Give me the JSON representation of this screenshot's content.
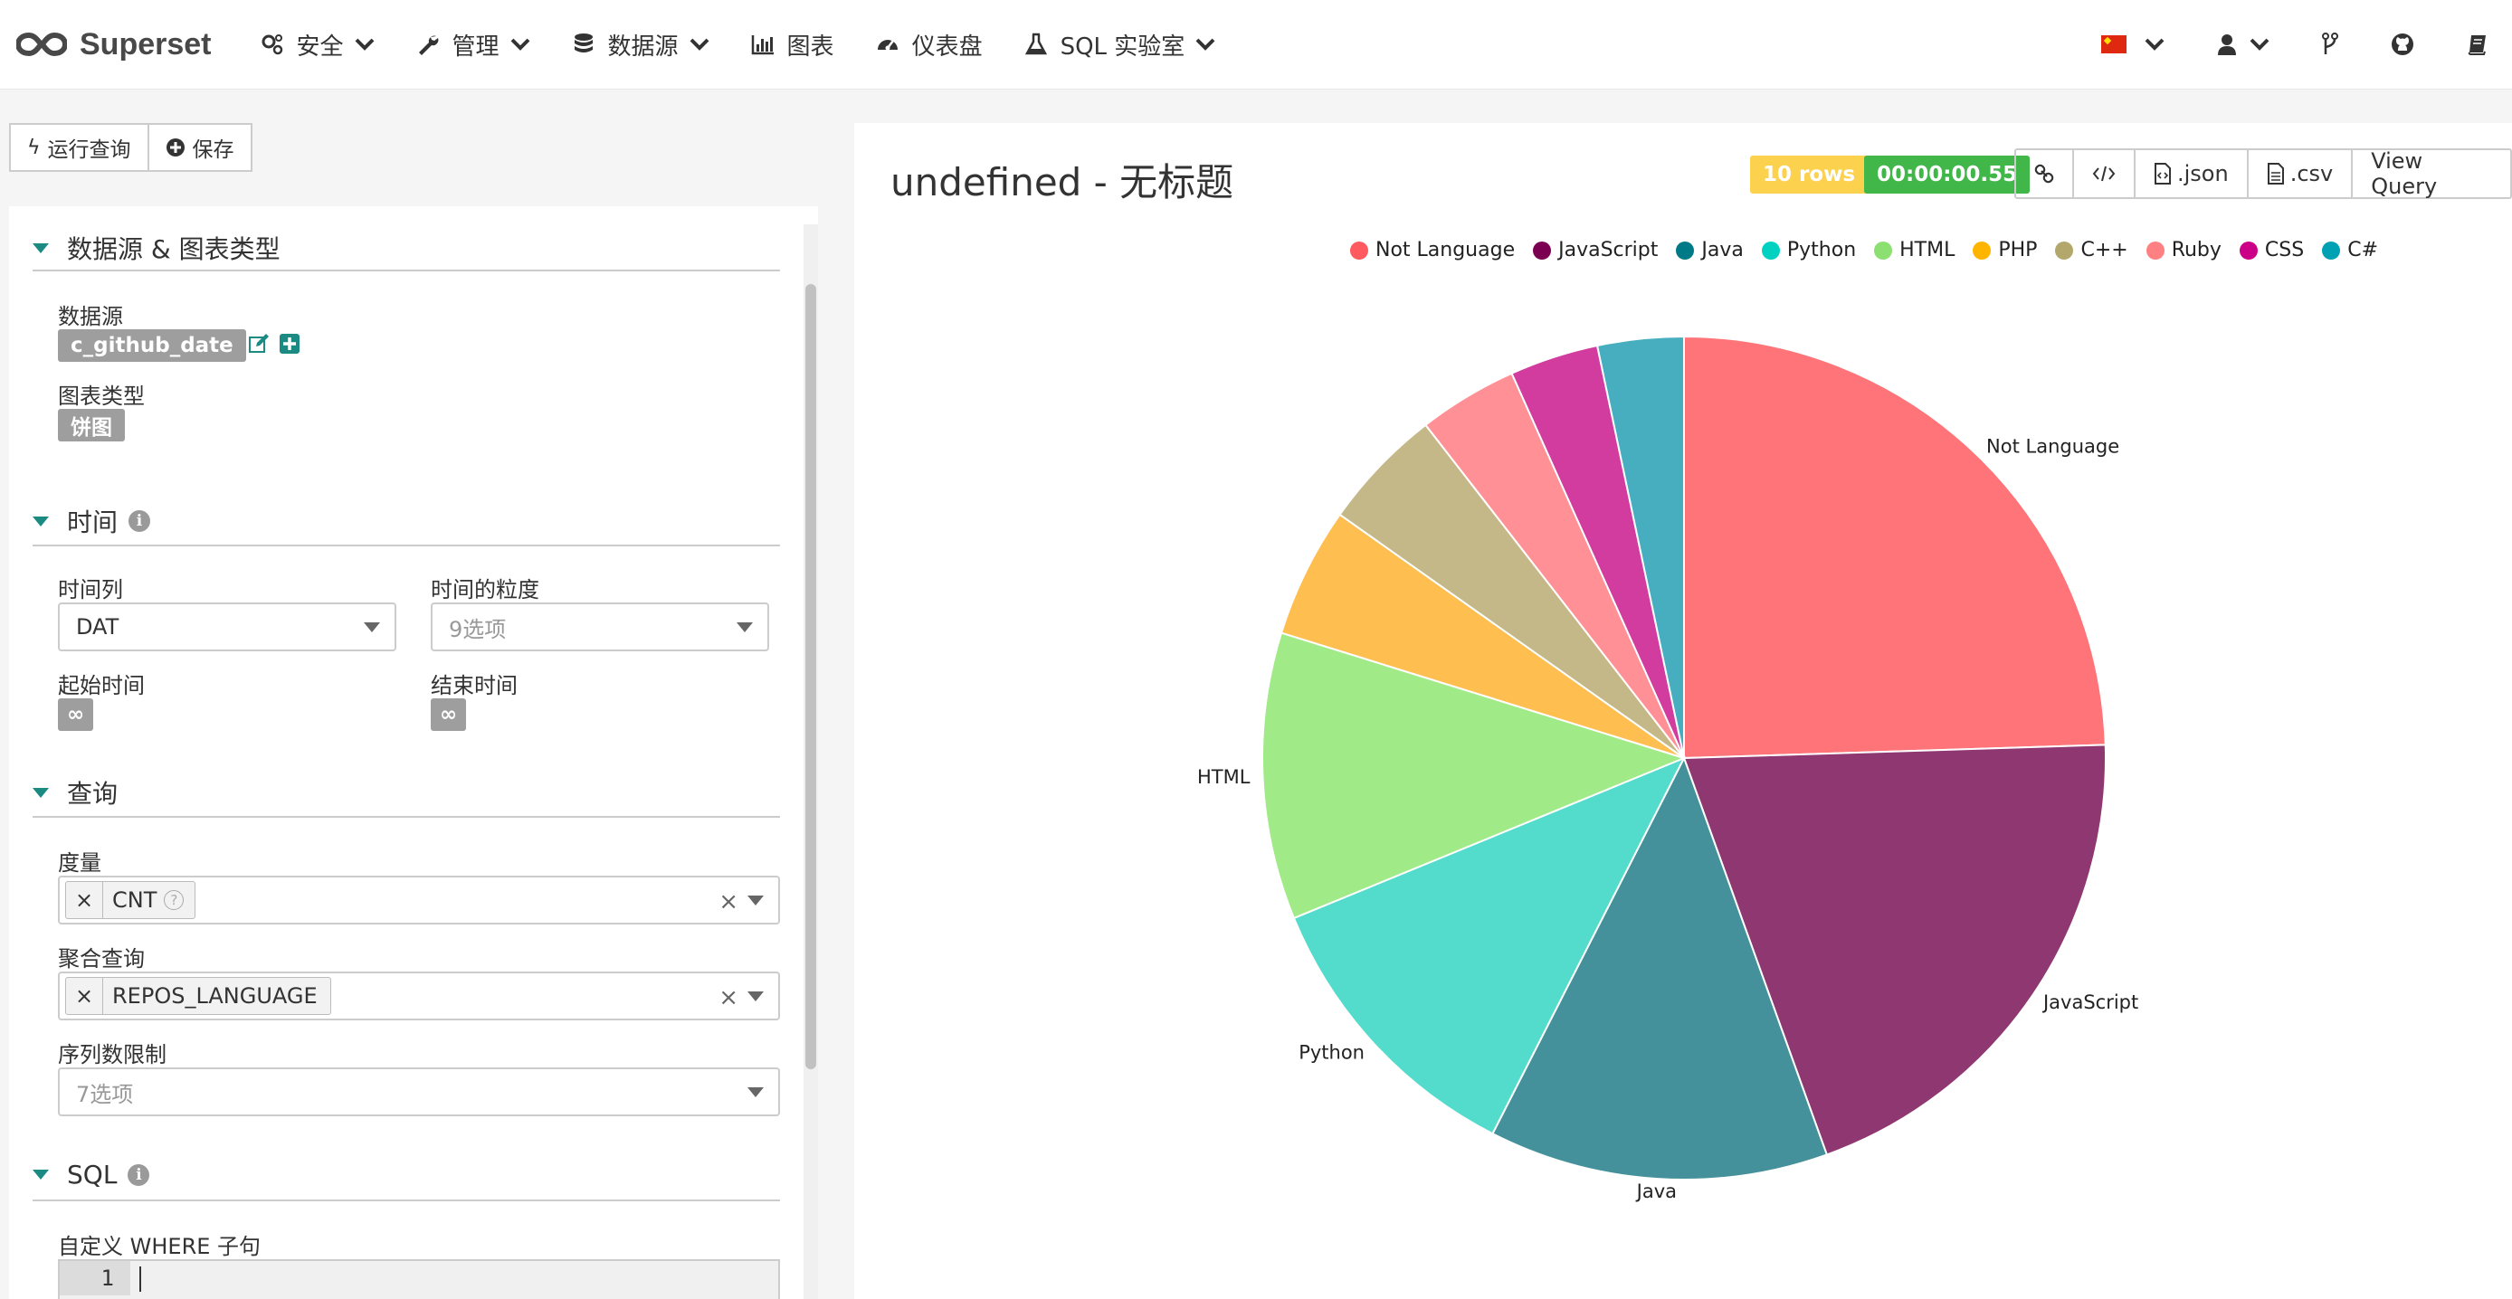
{
  "navbar": {
    "brand": "Superset",
    "items": [
      {
        "label": "安全",
        "icon": "gears-icon",
        "dropdown": true
      },
      {
        "label": "管理",
        "icon": "wrench-icon",
        "dropdown": true
      },
      {
        "label": "数据源",
        "icon": "database-icon",
        "dropdown": true
      },
      {
        "label": "图表",
        "icon": "bar-chart-icon",
        "dropdown": false
      },
      {
        "label": "仪表盘",
        "icon": "dashboard-icon",
        "dropdown": false
      },
      {
        "label": "SQL 实验室",
        "icon": "flask-icon",
        "dropdown": true
      }
    ],
    "right_icons": [
      "flag-cn-icon",
      "user-icon",
      "code-fork-icon",
      "github-icon",
      "book-icon"
    ]
  },
  "toolbar": {
    "run_label": "运行查询",
    "save_label": "保存"
  },
  "left_panel": {
    "section_datasource": {
      "title": "数据源 & 图表类型",
      "datasource_label": "数据源",
      "datasource_value": "c_github_date",
      "viz_type_label": "图表类型",
      "viz_type_value": "饼图"
    },
    "section_time": {
      "title": "时间",
      "time_column_label": "时间列",
      "time_column_value": "DAT",
      "time_grain_label": "时间的粒度",
      "time_grain_placeholder": "9选项",
      "since_label": "起始时间",
      "since_value": "∞",
      "until_label": "结束时间",
      "until_value": "∞"
    },
    "section_query": {
      "title": "查询",
      "metrics_label": "度量",
      "metrics_value": "CNT",
      "groupby_label": "聚合查询",
      "groupby_value": "REPOS_LANGUAGE",
      "row_limit_label": "序列数限制",
      "row_limit_placeholder": "7选项"
    },
    "section_sql": {
      "title": "SQL",
      "where_label": "自定义 WHERE 子句",
      "line_number": "1"
    }
  },
  "chart_panel": {
    "title": "undefined - 无标题",
    "rows_badge": "10 rows",
    "time_badge": "00:00:00.55",
    "buttons": {
      "link_icon": "link-icon",
      "embed_icon": "code-icon",
      "json_label": ".json",
      "csv_label": ".csv",
      "view_query_label": "View Query"
    }
  },
  "chart_data": {
    "type": "pie",
    "categories": [
      "Not Language",
      "JavaScript",
      "Java",
      "Python",
      "HTML",
      "PHP",
      "C++",
      "Ruby",
      "CSS",
      "C#"
    ],
    "values": [
      24.5,
      20.0,
      13.0,
      11.3,
      11.0,
      5.0,
      4.7,
      3.8,
      3.4,
      3.3
    ],
    "colors": [
      "#ff7478",
      "#8e3770",
      "#45919b",
      "#53dccb",
      "#a0ea87",
      "#ffbe50",
      "#c4b888",
      "#ff9096",
      "#d23c9e",
      "#47aec0"
    ],
    "legend_colors": [
      "#ff5a5f",
      "#7b0051",
      "#007a87",
      "#00d1c1",
      "#8ce071",
      "#ffb400",
      "#b4a76c",
      "#ff8083",
      "#cc0086",
      "#00a1b3"
    ],
    "slice_labels_shown": [
      "Not Language",
      "JavaScript",
      "Java",
      "Python",
      "HTML"
    ],
    "legend_position": "top"
  }
}
